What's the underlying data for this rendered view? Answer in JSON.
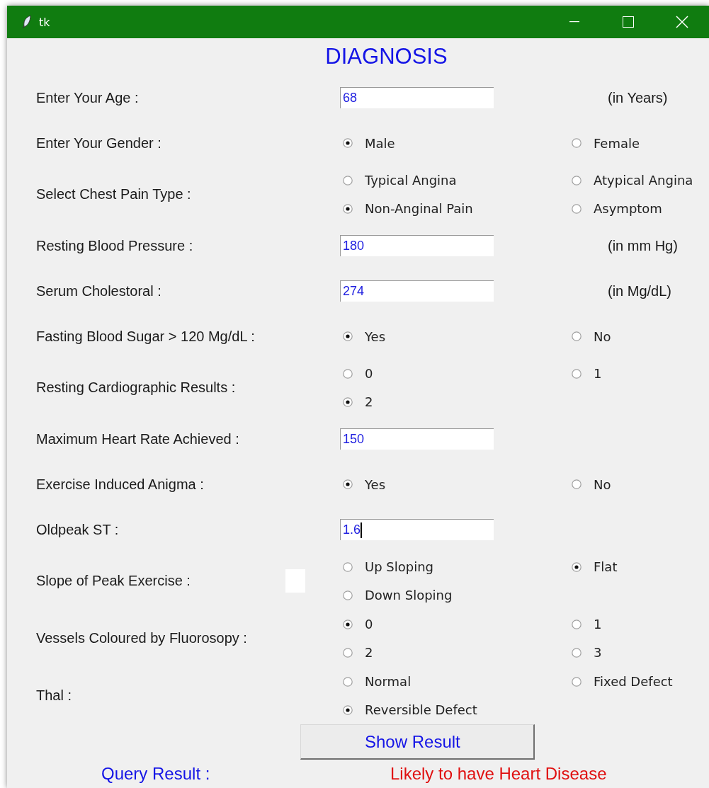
{
  "window": {
    "title": "tk"
  },
  "heading": "DIAGNOSIS",
  "fields": [
    {
      "kind": "entry",
      "label": "Enter Your Age :",
      "value": "68",
      "unit": "(in Years)",
      "focused": false
    },
    {
      "kind": "radio",
      "label": "Enter Your Gender :",
      "options": [
        {
          "label": "Male",
          "selected": true
        },
        {
          "label": "Female",
          "selected": false
        }
      ]
    },
    {
      "kind": "radio",
      "label": "Select Chest Pain Type :",
      "options": [
        {
          "label": "Typical Angina",
          "selected": false
        },
        {
          "label": "Atypical Angina",
          "selected": false
        },
        {
          "label": "Non-Anginal Pain",
          "selected": true
        },
        {
          "label": "Asymptom",
          "selected": false
        }
      ]
    },
    {
      "kind": "entry",
      "label": "Resting Blood Pressure :",
      "value": "180",
      "unit": "(in mm Hg)",
      "focused": false
    },
    {
      "kind": "entry",
      "label": "Serum Cholestoral :",
      "value": "274",
      "unit": "(in Mg/dL)",
      "focused": false
    },
    {
      "kind": "radio",
      "label": "Fasting Blood Sugar > 120 Mg/dL :",
      "options": [
        {
          "label": "Yes",
          "selected": true
        },
        {
          "label": "No",
          "selected": false
        }
      ]
    },
    {
      "kind": "radio",
      "label": "Resting Cardiographic Results :",
      "options": [
        {
          "label": "0",
          "selected": false
        },
        {
          "label": "1",
          "selected": false
        },
        {
          "label": "2",
          "selected": true
        }
      ]
    },
    {
      "kind": "entry",
      "label": "Maximum Heart Rate Achieved :",
      "value": "150",
      "focused": false
    },
    {
      "kind": "radio",
      "label": "Exercise Induced Anigma :",
      "options": [
        {
          "label": "Yes",
          "selected": true
        },
        {
          "label": "No",
          "selected": false
        }
      ]
    },
    {
      "kind": "entry",
      "label": "Oldpeak ST :",
      "value": "1.6",
      "focused": true
    },
    {
      "kind": "radio",
      "label": "Slope of Peak Exercise :",
      "blank_box": true,
      "options": [
        {
          "label": "Up Sloping",
          "selected": false
        },
        {
          "label": "Flat",
          "selected": true
        },
        {
          "label": "Down Sloping",
          "selected": false
        }
      ]
    },
    {
      "kind": "radio",
      "label": "Vessels Coloured by Fluorosopy :",
      "options": [
        {
          "label": "0",
          "selected": true
        },
        {
          "label": "1",
          "selected": false
        },
        {
          "label": "2",
          "selected": false
        },
        {
          "label": "3",
          "selected": false
        }
      ]
    },
    {
      "kind": "radio",
      "label": "Thal :",
      "options": [
        {
          "label": "Normal",
          "selected": false
        },
        {
          "label": "Fixed Defect",
          "selected": false
        },
        {
          "label": "Reversible Defect",
          "selected": true
        }
      ]
    }
  ],
  "button": "Show Result",
  "query": {
    "label": "Query Result :",
    "value": "Likely to have Heart Disease"
  }
}
